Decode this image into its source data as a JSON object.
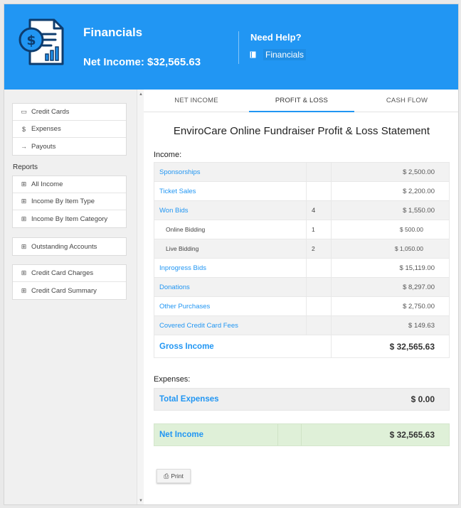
{
  "header": {
    "title": "Financials",
    "net_income": "Net Income: $32,565.63",
    "help_title": "Need Help?",
    "help_link": "Financials",
    "icon": "financial-report-icon"
  },
  "sidebar": {
    "group1": [
      {
        "label": "Credit Cards",
        "icon": "credit-card-icon"
      },
      {
        "label": "Expenses",
        "icon": "money-icon"
      },
      {
        "label": "Payouts",
        "icon": "arrow-right-icon"
      }
    ],
    "reports_label": "Reports",
    "group2": [
      {
        "label": "All Income",
        "icon": "grid-icon"
      },
      {
        "label": "Income By Item Type",
        "icon": "grid-icon"
      },
      {
        "label": "Income By Item Category",
        "icon": "grid-icon"
      }
    ],
    "group3": [
      {
        "label": "Outstanding Accounts",
        "icon": "grid-icon"
      }
    ],
    "group4": [
      {
        "label": "Credit Card Charges",
        "icon": "grid-icon"
      },
      {
        "label": "Credit Card Summary",
        "icon": "grid-icon"
      }
    ]
  },
  "tabs": [
    {
      "label": "NET INCOME"
    },
    {
      "label": "PROFIT & LOSS",
      "active": true
    },
    {
      "label": "CASH FLOW"
    }
  ],
  "statement": {
    "title": "EnviroCare Online Fundraiser Profit & Loss Statement",
    "income_label": "Income:",
    "income_rows": [
      {
        "label": "Sponsorships",
        "qty": "",
        "amount": "$ 2,500.00"
      },
      {
        "label": "Ticket Sales",
        "qty": "",
        "amount": "$ 2,200.00"
      },
      {
        "label": "Won Bids",
        "qty": "4",
        "amount": "$ 1,550.00"
      },
      {
        "label": "Online Bidding",
        "qty": "1",
        "amount": "$ 500.00",
        "sub": true
      },
      {
        "label": "Live Bidding",
        "qty": "2",
        "amount": "$ 1,050.00",
        "sub": true
      },
      {
        "label": "Inprogress Bids",
        "qty": "",
        "amount": "$ 15,119.00"
      },
      {
        "label": "Donations",
        "qty": "",
        "amount": "$ 8,297.00"
      },
      {
        "label": "Other Purchases",
        "qty": "",
        "amount": "$ 2,750.00"
      },
      {
        "label": "Covered Credit Card Fees",
        "qty": "",
        "amount": "$ 149.63"
      }
    ],
    "gross_label": "Gross Income",
    "gross_amount": "$ 32,565.63",
    "expenses_label": "Expenses:",
    "total_expenses_label": "Total Expenses",
    "total_expenses_amount": "$ 0.00",
    "net_income_label": "Net Income",
    "net_income_amount": "$ 32,565.63",
    "print_label": "Print"
  }
}
